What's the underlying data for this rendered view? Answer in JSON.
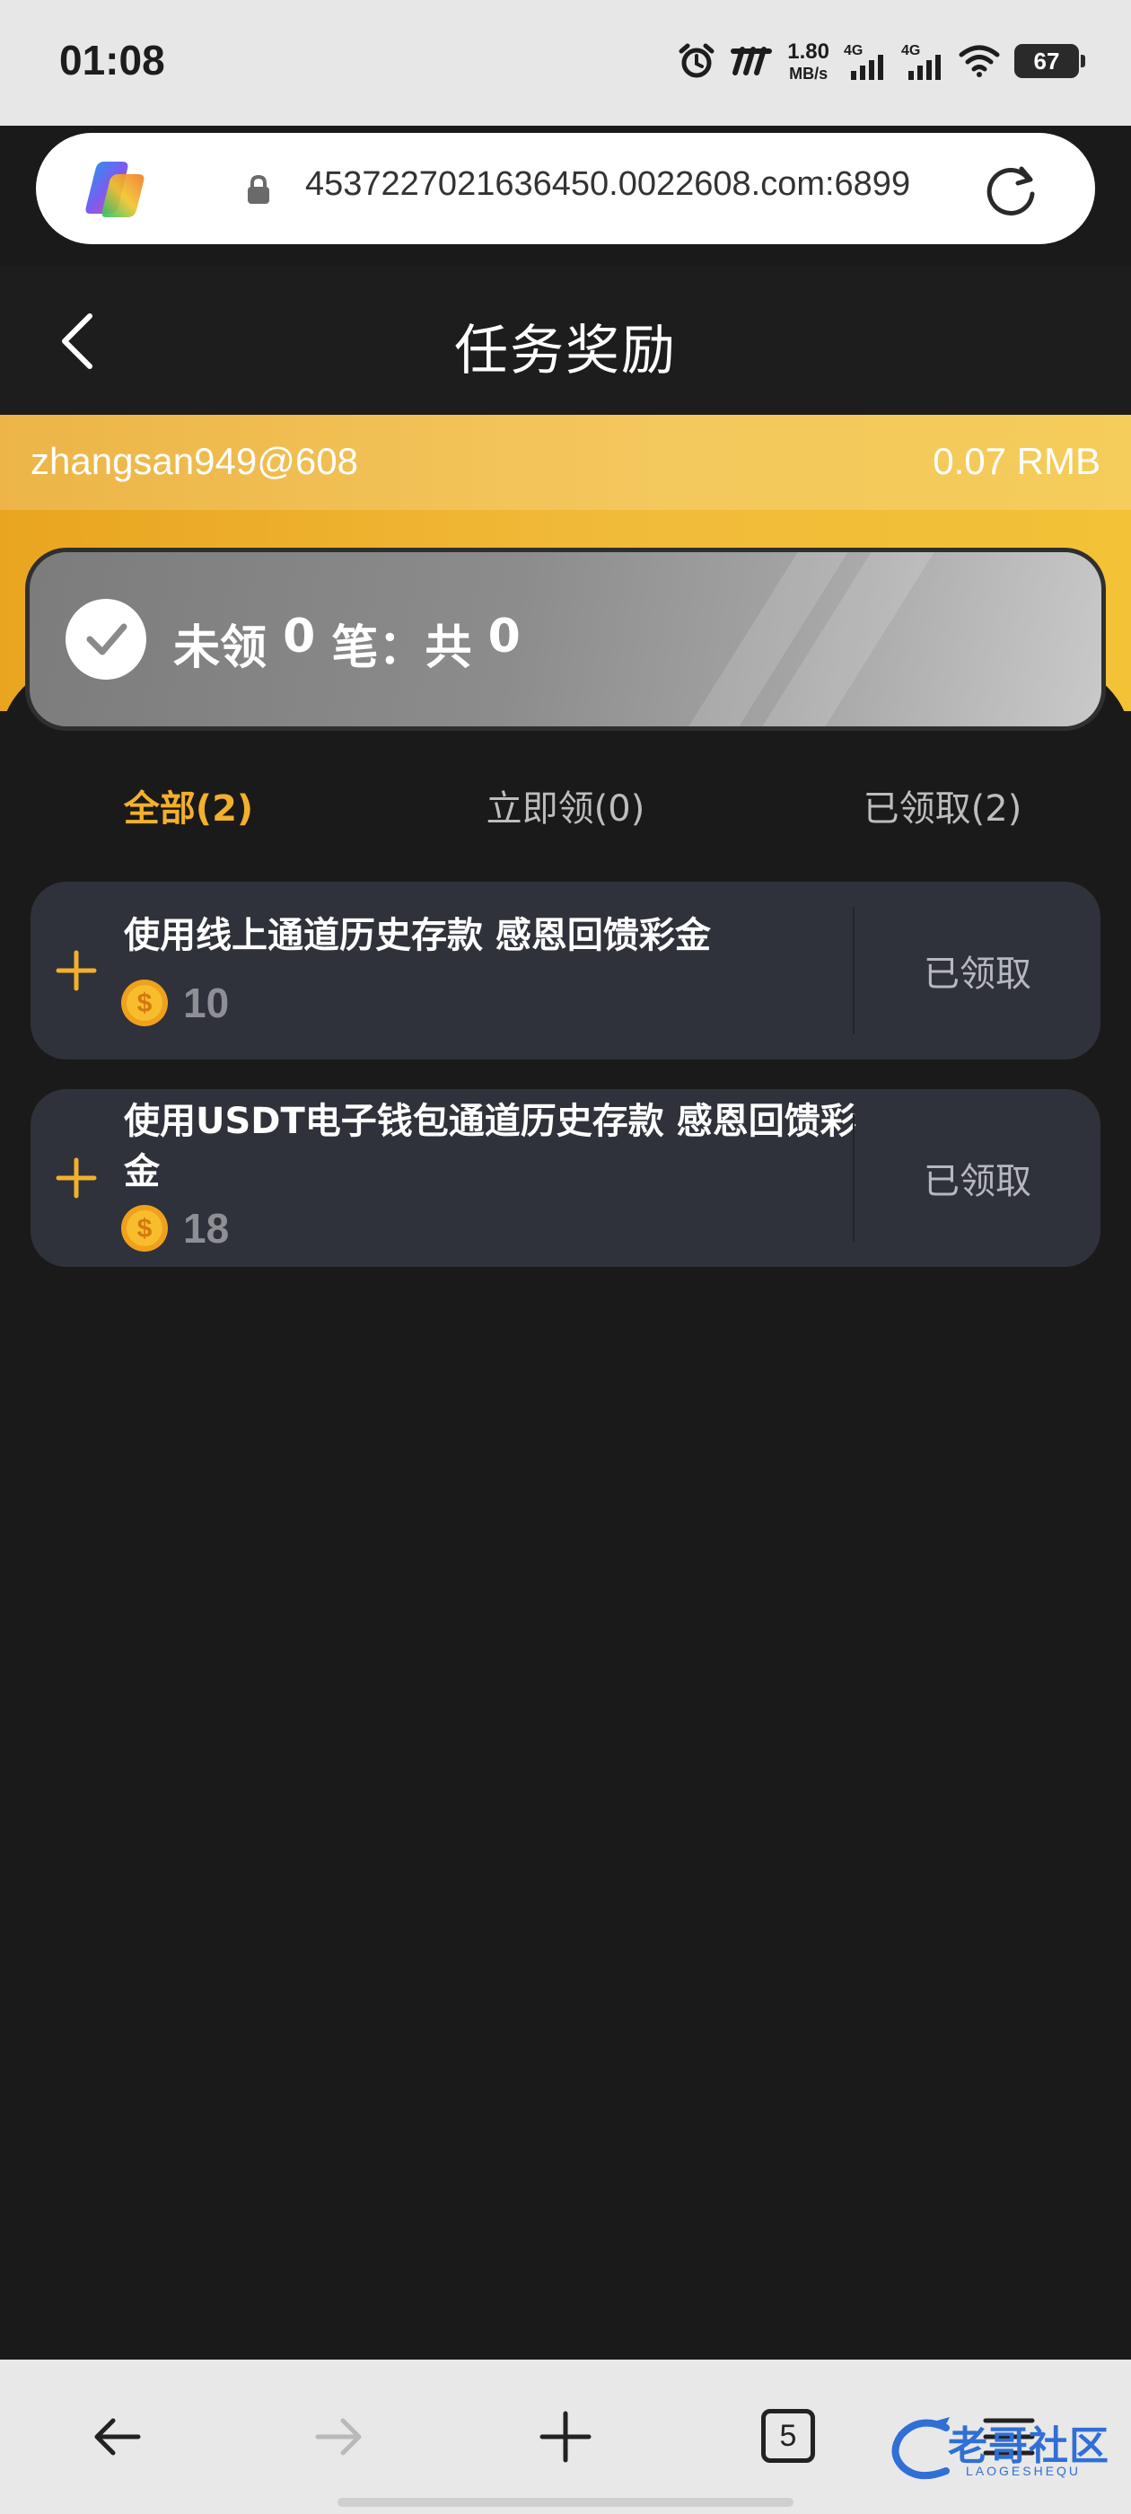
{
  "status_bar": {
    "time": "01:08",
    "net_speed_value": "1.80",
    "net_speed_unit": "MB/s",
    "signal_1_label": "4G",
    "signal_2_label": "4G",
    "battery": "67"
  },
  "browser": {
    "url": "4537227021636450.0022608.com:6899"
  },
  "header": {
    "title": "任务奖励"
  },
  "account": {
    "username": "zhangsan949@608",
    "balance": "0.07 RMB"
  },
  "summary": {
    "unclaimed_label": "未领",
    "unclaimed_count": "0",
    "count_unit_label": "笔：",
    "total_label": "共",
    "total_count": "0"
  },
  "tabs": [
    {
      "label": "全部(2)",
      "active": true
    },
    {
      "label": "立即领(0)",
      "active": false
    },
    {
      "label": "已领取(2)",
      "active": false
    }
  ],
  "tasks": [
    {
      "title": "使用线上通道历史存款 感恩回馈彩金",
      "reward": "10",
      "status": "已领取"
    },
    {
      "title": "使用USDT电子钱包通道历史存款 感恩回馈彩金",
      "reward": "18",
      "status": "已领取"
    }
  ],
  "bottom_nav": {
    "tab_count": "5"
  },
  "watermark": {
    "text": "老哥社区",
    "sub": "LAOGESHEQU"
  },
  "colors": {
    "accent": "#f3b02c",
    "card_bg": "#2f323b",
    "page_bg": "#1a1a1a"
  }
}
